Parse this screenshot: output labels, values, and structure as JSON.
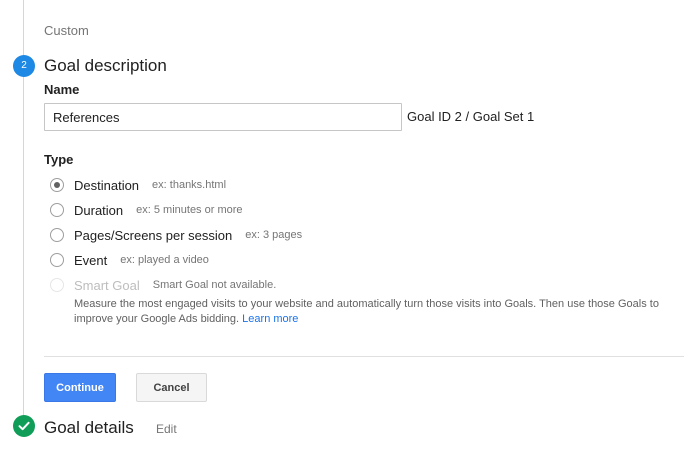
{
  "previous_step": {
    "label": "Custom"
  },
  "step": {
    "number": "2",
    "title": "Goal description"
  },
  "name_field": {
    "label": "Name",
    "value": "References"
  },
  "goal_id_text": "Goal ID 2 / Goal Set 1",
  "type_section": {
    "label": "Type",
    "options": [
      {
        "label": "Destination",
        "hint": "ex: thanks.html",
        "checked": true
      },
      {
        "label": "Duration",
        "hint": "ex: 5 minutes or more",
        "checked": false
      },
      {
        "label": "Pages/Screens per session",
        "hint": "ex: 3 pages",
        "checked": false
      },
      {
        "label": "Event",
        "hint": "ex: played a video",
        "checked": false
      },
      {
        "label": "Smart Goal",
        "hint": "Smart Goal not available.",
        "checked": false,
        "disabled": true
      }
    ],
    "smart_goal_description": "Measure the most engaged visits to your website and automatically turn those visits into Goals. Then use those Goals to improve your Google Ads bidding.",
    "learn_more": "Learn more"
  },
  "buttons": {
    "continue": "Continue",
    "cancel": "Cancel"
  },
  "next_step": {
    "title": "Goal details",
    "edit": "Edit"
  },
  "colors": {
    "accent": "#1e88e5",
    "primary_button": "#4285f4",
    "success": "#0f9d58",
    "link": "#1a73e8"
  }
}
